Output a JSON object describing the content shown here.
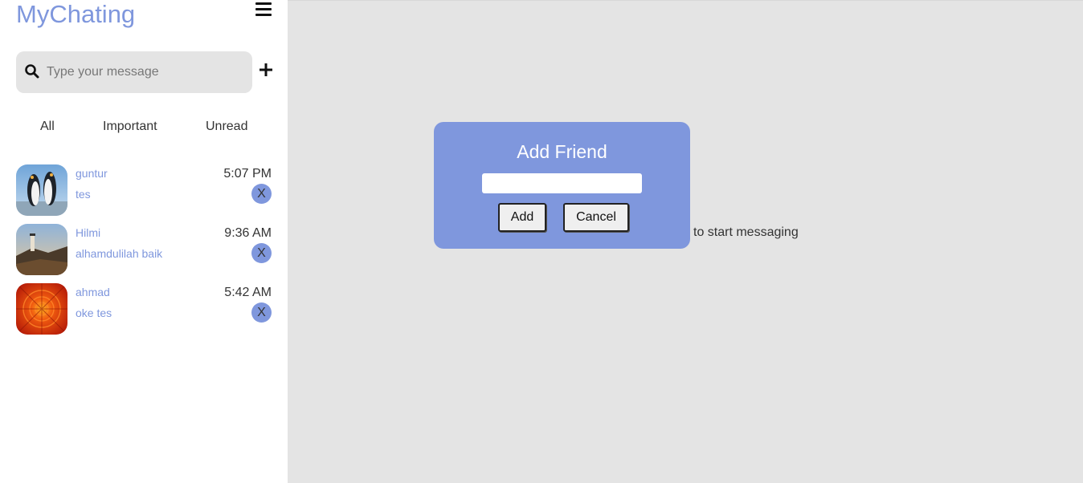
{
  "app": {
    "title": "MyChating"
  },
  "search": {
    "placeholder": "Type your message"
  },
  "tabs": [
    "All",
    "Important",
    "Unread"
  ],
  "chats": [
    {
      "name": "guntur",
      "message": "tes",
      "time": "5:07 PM",
      "close": "X",
      "avatar": "penguins-photo"
    },
    {
      "name": "Hilmi",
      "message": "alhamdulilah baik",
      "time": "9:36 AM",
      "close": "X",
      "avatar": "lighthouse-photo"
    },
    {
      "name": "ahmad",
      "message": "oke tes",
      "time": "5:42 AM",
      "close": "X",
      "avatar": "chrysanthemum-photo"
    }
  ],
  "main": {
    "hint": "to start messaging"
  },
  "modal": {
    "title": "Add Friend",
    "input_value": "",
    "add_label": "Add",
    "cancel_label": "Cancel"
  },
  "colors": {
    "accent": "#7f97dd",
    "main_bg": "#e4e4e4",
    "search_bg": "#e4e4e4"
  }
}
